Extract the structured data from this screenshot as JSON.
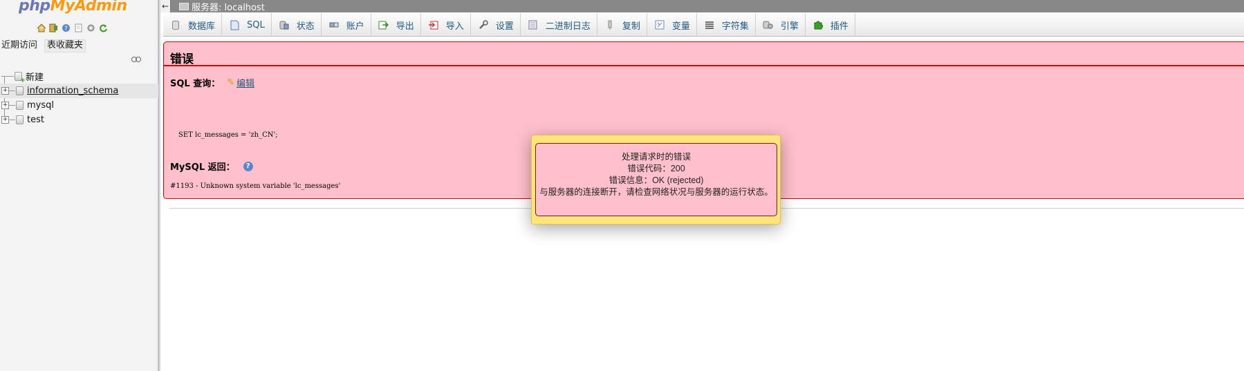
{
  "nav": {
    "logo_part1": "php",
    "logo_part2": "MyAdmin",
    "tabs": [
      "近期访问",
      "表收藏夹"
    ],
    "tree": [
      {
        "label": "新建"
      },
      {
        "label": "information_schema"
      },
      {
        "label": "mysql"
      },
      {
        "label": "test"
      }
    ]
  },
  "serverbar": {
    "back": "←",
    "label": "服务器: localhost"
  },
  "menu": [
    {
      "label": "数据库"
    },
    {
      "label": "SQL"
    },
    {
      "label": "状态"
    },
    {
      "label": "账户"
    },
    {
      "label": "导出"
    },
    {
      "label": "导入"
    },
    {
      "label": "设置"
    },
    {
      "label": "二进制日志"
    },
    {
      "label": "复制"
    },
    {
      "label": "变量"
    },
    {
      "label": "字符集"
    },
    {
      "label": "引擎"
    },
    {
      "label": "插件"
    }
  ],
  "error": {
    "title": "错误",
    "sql_label": "SQL 查询：",
    "edit_label": "编辑",
    "sql_code": "SET lc_messages = 'zh_CN';",
    "mysql_label": "MySQL 返回：",
    "message": "#1193 - Unknown system variable 'lc_messages'"
  },
  "popup": {
    "line1": "处理请求时的错误",
    "line2": "错误代码：200",
    "line3": "错误信息：OK (rejected)",
    "line4": "与服务器的连接断开，请检查网络状况与服务器的运行状态。"
  },
  "colors": {
    "error_bg": "#ffc0cb",
    "error_border": "#cc0000",
    "popup_bg": "#ffe57a",
    "link": "#235a81"
  }
}
